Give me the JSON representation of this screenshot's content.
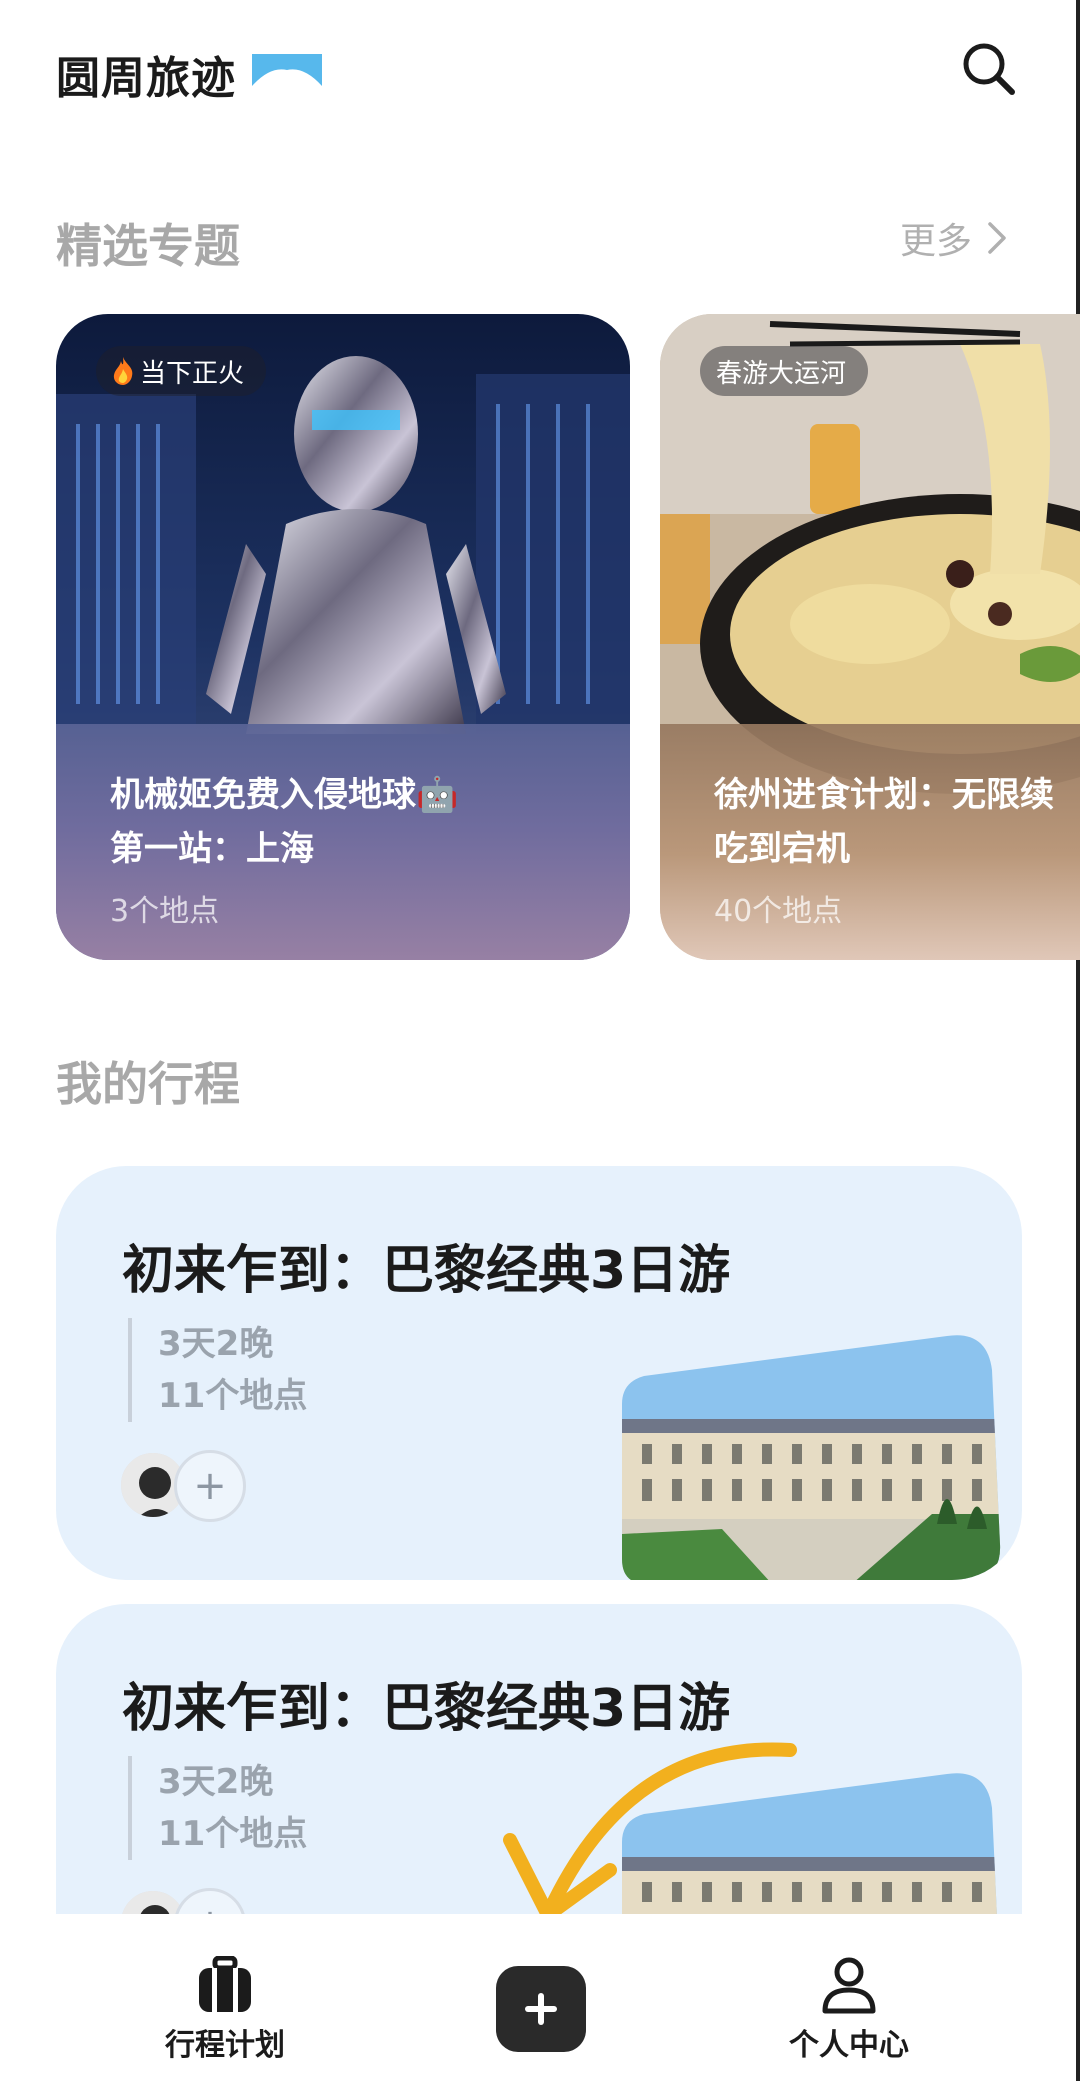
{
  "header": {
    "app_title": "圆周旅迹",
    "search_label": "search"
  },
  "featured": {
    "section_title": "精选专题",
    "more_label": "更多",
    "cards": [
      {
        "tag": "当下正火",
        "title_line1": "机械姬免费入侵地球🤖",
        "title_line2": "第一站：上海",
        "count": "3个地点"
      },
      {
        "tag": "春游大运河",
        "title_line1": "徐州进食计划：无限续",
        "title_line2": "吃到宕机",
        "count": "40个地点"
      }
    ]
  },
  "trips": {
    "section_title": "我的行程",
    "items": [
      {
        "title": "初来乍到：巴黎经典3日游",
        "duration": "3天2晚",
        "places": "11个地点",
        "add_label": "+"
      },
      {
        "title": "初来乍到：巴黎经典3日游",
        "duration": "3天2晚",
        "places": "11个地点",
        "add_label": "+"
      }
    ]
  },
  "bottom_nav": {
    "trips_label": "行程计划",
    "add_label": "+",
    "profile_label": "个人中心"
  },
  "colors": {
    "trip_card_bg": "#e6f1fc",
    "accent_logo": "#57b8ec",
    "annotation_arrow": "#f2b01e"
  },
  "icons": {
    "search": "search-icon",
    "more": "chevron-right-icon",
    "fire": "fire-icon",
    "trips_nav": "suitcase-icon",
    "add": "plus-icon",
    "profile": "person-icon"
  }
}
